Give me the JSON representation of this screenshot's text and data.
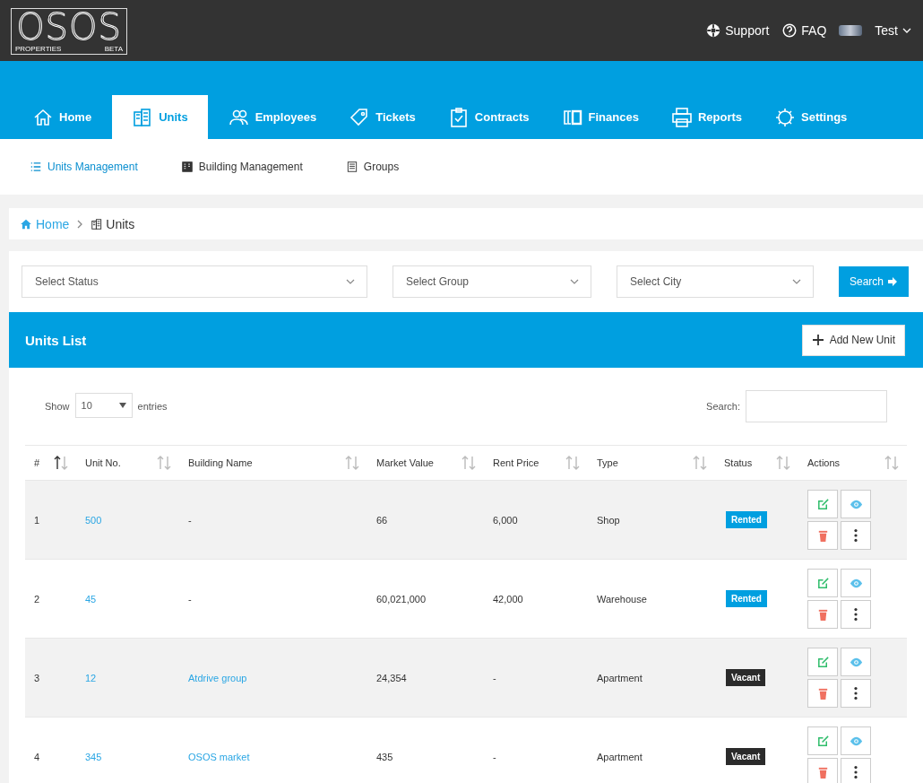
{
  "header": {
    "logo_text": "OSOS",
    "logo_sub_left": "PROPERTIES",
    "logo_sub_right": "BETA",
    "links": [
      "Support",
      "FAQ"
    ],
    "user": "Test"
  },
  "tabs": [
    {
      "label": "Home",
      "selected": false
    },
    {
      "label": "Units",
      "selected": true
    },
    {
      "label": "Employees",
      "selected": false
    },
    {
      "label": "Tickets",
      "selected": false
    },
    {
      "label": "Contracts",
      "selected": false
    },
    {
      "label": "Finances",
      "selected": false
    },
    {
      "label": "Reports",
      "selected": false
    },
    {
      "label": "Settings",
      "selected": false
    }
  ],
  "subnav": [
    {
      "label": "Units Management",
      "selected": true
    },
    {
      "label": "Building Management",
      "selected": false
    },
    {
      "label": "Groups",
      "selected": false
    }
  ],
  "breadcrumb": [
    "Home",
    "Units"
  ],
  "filters": {
    "selects": [
      "Select Status",
      "Select Group",
      "Select City"
    ],
    "search_button": "Search"
  },
  "units_list": {
    "title": "Units List",
    "add_button": "Add New Unit",
    "show_label": "Show",
    "entries_value": "10",
    "entries_label": "entries",
    "search_label": "Search:",
    "columns": [
      {
        "label": "#",
        "sorted": true
      },
      {
        "label": "Unit No.",
        "sorted": false
      },
      {
        "label": "Building Name",
        "sorted": false
      },
      {
        "label": "Market Value",
        "sorted": false
      },
      {
        "label": "Rent Price",
        "sorted": false
      },
      {
        "label": "Type",
        "sorted": false
      },
      {
        "label": "Status",
        "sorted": false
      },
      {
        "label": "Actions",
        "sorted": false
      }
    ],
    "rows": [
      {
        "index": "1",
        "unit_no": "500",
        "building": "-",
        "building_is_link": false,
        "market_value": "66",
        "rent_price": "6,000",
        "type": "Shop",
        "status": "Rented",
        "color": "#009fe0"
      },
      {
        "index": "2",
        "unit_no": "45",
        "building": "-",
        "building_is_link": false,
        "market_value": "60,021,000",
        "rent_price": "42,000",
        "type": "Warehouse",
        "status": "Rented",
        "color": "#009fe0"
      },
      {
        "index": "3",
        "unit_no": "12",
        "building": "Atdrive group",
        "building_is_link": true,
        "market_value": "24,354",
        "rent_price": "-",
        "type": "Apartment",
        "status": "Vacant",
        "color": "#2b2b2b"
      },
      {
        "index": "4",
        "unit_no": "345",
        "building": "OSOS market",
        "building_is_link": true,
        "market_value": "435",
        "rent_price": "-",
        "type": "Apartment",
        "status": "Vacant",
        "color": "#2b2b2b"
      }
    ]
  }
}
